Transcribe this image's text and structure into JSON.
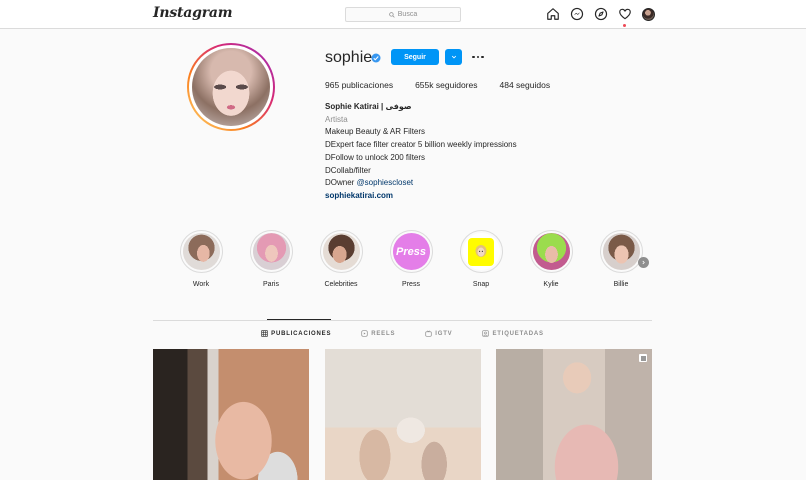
{
  "nav": {
    "logo": "Instagram",
    "search_placeholder": "Busca",
    "icons": [
      "home-icon",
      "messenger-icon",
      "explore-icon",
      "heart-icon",
      "profile-avatar"
    ]
  },
  "profile": {
    "username": "sophie",
    "verified": true,
    "follow_label": "Seguir",
    "stats": {
      "posts_count": "965",
      "posts_label": "publicaciones",
      "followers_count": "655k",
      "followers_label": "seguidores",
      "following_count": "484",
      "following_label": "seguidos"
    },
    "bio": {
      "full_name": "Sophie Katirai | صوفی",
      "category": "Artista",
      "lines": [
        "Makeup Beauty & AR Filters",
        "DExpert face filter creator 5 billion weekly impressions",
        "DFollow to unlock 200 filters",
        "DCollab/filter"
      ],
      "owner_prefix": "DOwner ",
      "owner_mention": "@sophiescloset",
      "website": "sophiekatirai.com"
    }
  },
  "highlights": [
    {
      "label": "Work"
    },
    {
      "label": "Paris"
    },
    {
      "label": "Celebrities"
    },
    {
      "label": "Press",
      "cover_text": "Press"
    },
    {
      "label": "Snap"
    },
    {
      "label": "Kylie"
    },
    {
      "label": "Billie"
    }
  ],
  "tabs": [
    {
      "label": "PUBLICACIONES",
      "active": true,
      "icon": "grid-icon"
    },
    {
      "label": "REELS",
      "active": false,
      "icon": "reels-icon"
    },
    {
      "label": "IGTV",
      "active": false,
      "icon": "igtv-icon"
    },
    {
      "label": "ETIQUETADAS",
      "active": false,
      "icon": "tagged-icon"
    }
  ],
  "colors": {
    "accent": "#0095f6",
    "background": "#fafafa",
    "text": "#262626",
    "muted": "#8e8e8e",
    "link": "#00376b",
    "notification": "#ed4956"
  }
}
